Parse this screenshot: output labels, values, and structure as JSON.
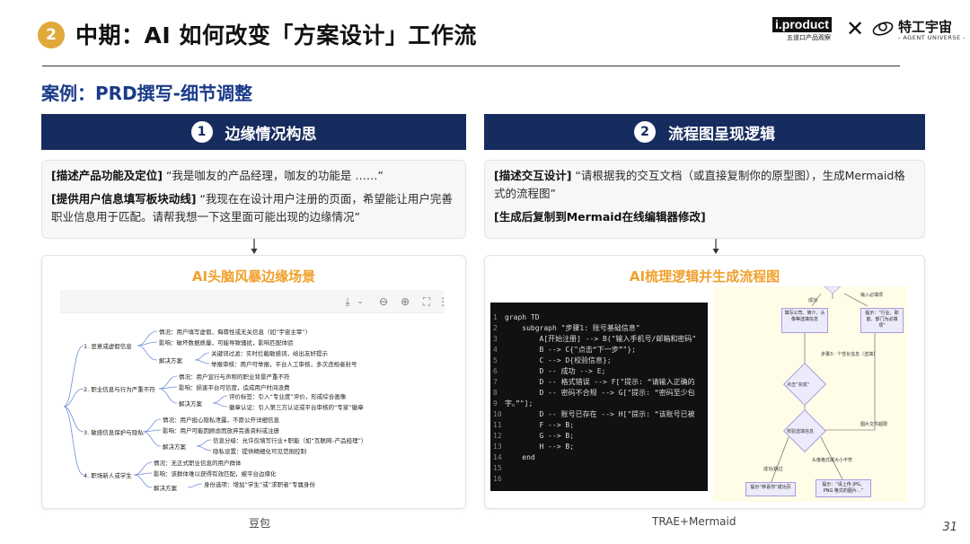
{
  "header": {
    "section_number": "2",
    "title": "中期：AI 如何改变「方案设计」工作流",
    "brand_left": "i.product",
    "brand_left_sub": "五道口产品观察",
    "brand_x": "✕",
    "brand_right": "特工宇宙",
    "brand_right_sub": "- AGENT UNIVERSE -"
  },
  "case_title": "案例：PRD撰写-细节调整",
  "left": {
    "step_number": "1",
    "step_title": "边缘情况构思",
    "desc_p1_bold": "[描述产品功能及定位]",
    "desc_p1_text": " “我是咖友的产品经理，咖友的功能是 ……”",
    "desc_p2_bold": "[提供用户信息填写板块动线]",
    "desc_p2_text": " “我现在在设计用户注册的页面，希望能让用户完善职业信息用于匹配。请帮我想一下这里面可能出现的边缘情况”",
    "panel_title": "AI头脑风暴边缘场景",
    "caption": "豆包",
    "mindmap": {
      "toolbar_icons": [
        "download-icon",
        "zoom-out-icon",
        "zoom-in-icon",
        "fit-screen-icon",
        "more-icon"
      ],
      "branches": [
        {
          "label": "1. 恶意或虚假信息",
          "items": [
            "情况：用户填写虚假、侮辱性或无关信息（如“宇宙主宰”）",
            "影响：破坏数据质量，可能导致骚扰，影响匹配体验",
            "解决方案",
            "关键词过滤：实时拦截敏感词，给出友好提示",
            "举报审核：用户可举报，平台人工审核，多次违规者封号"
          ]
        },
        {
          "label": "2. 职业信息与行为严重不符",
          "items": [
            "情况：用户宣行与声称的职业背景严重不符",
            "影响：损害平台可信度，造成用户时间浪费",
            "解决方案",
            "评价标签：引入“专业度”评价，形成综合画像",
            "徽章认证：引入第三方认证或平台审核的“专家”徽章"
          ]
        },
        {
          "label": "3. 敏感信息保护与隐私",
          "items": [
            "情况：用户担心隐私泄露，不愿公开详细信息",
            "影响：用户可能因顾虑而放弃完善资料或注册",
            "解决方案",
            "信息分级：允许仅填写行业+职能（如“互联网–产品经理”）",
            "隐私设置：提供精细化可见范围控制"
          ]
        },
        {
          "label": "4. 职场新人或学生",
          "items": [
            "情况：无正式职业信息的用户群体",
            "影响：该群体难以获得有效匹配，被平台边缘化",
            "解决方案",
            "身份选项：增加“学生”或“求职者”专属身份"
          ]
        }
      ]
    }
  },
  "right": {
    "step_number": "2",
    "step_title": "流程图呈现逻辑",
    "desc_p1_bold": "[描述交互设计]",
    "desc_p1_text": " “请根据我的交互文档（或直接复制你的原型图），生成Mermaid格式的流程图”",
    "desc_p2_bold": "[生成后复制到Mermaid在线编辑器修改]",
    "panel_title": "AI梳理逻辑并生成流程图",
    "caption": "TRAE+Mermaid",
    "code_lines": [
      "graph TD",
      "    subgraph \"步骤1: 账号基础信息\"",
      "        A[开始注册] --> B(\"输入手机号/邮箱和密码\"",
      "        B --> C{\"点击“下一步”\"};",
      "        C --> D{校验信息};",
      "        D -- 成功 --> E;",
      "        D -- 格式错误 --> F[\"提示: “请输入正确的",
      "        D -- 密码不合规 --> G[\"提示: “密码至少包",
      "字。”\"];",
      "        D -- 账号已存在 --> H[\"提示: “该账号已被",
      "        F --> B;",
      "        G --> B;",
      "        H --> B;",
      "    end"
    ],
    "line_numbers": [
      "1",
      "2",
      "3",
      "4",
      "5",
      "6",
      "7",
      "8",
      "9",
      "10",
      "11",
      "12",
      "13",
      "14",
      "15",
      "16"
    ],
    "flow": {
      "top_label": "成功",
      "top_label2": "输入必填项",
      "node1": "填写公司、简介、头像等选填信息",
      "node2": "提示：“行业、职能、部门为必填项”",
      "side_label": "步骤3：个性化信息（选填）",
      "diamond1": "点击“完成”",
      "diamond2": "校验选填信息",
      "label_fail": "图片文件超限",
      "label_size": "头像格式或大小不符",
      "label_ok": "成功/跳过",
      "node3": "提示“恭喜你”成功页",
      "node4": "提示：“请上传 JPG、PNG 格式的图片...”"
    }
  },
  "page_number": "31"
}
